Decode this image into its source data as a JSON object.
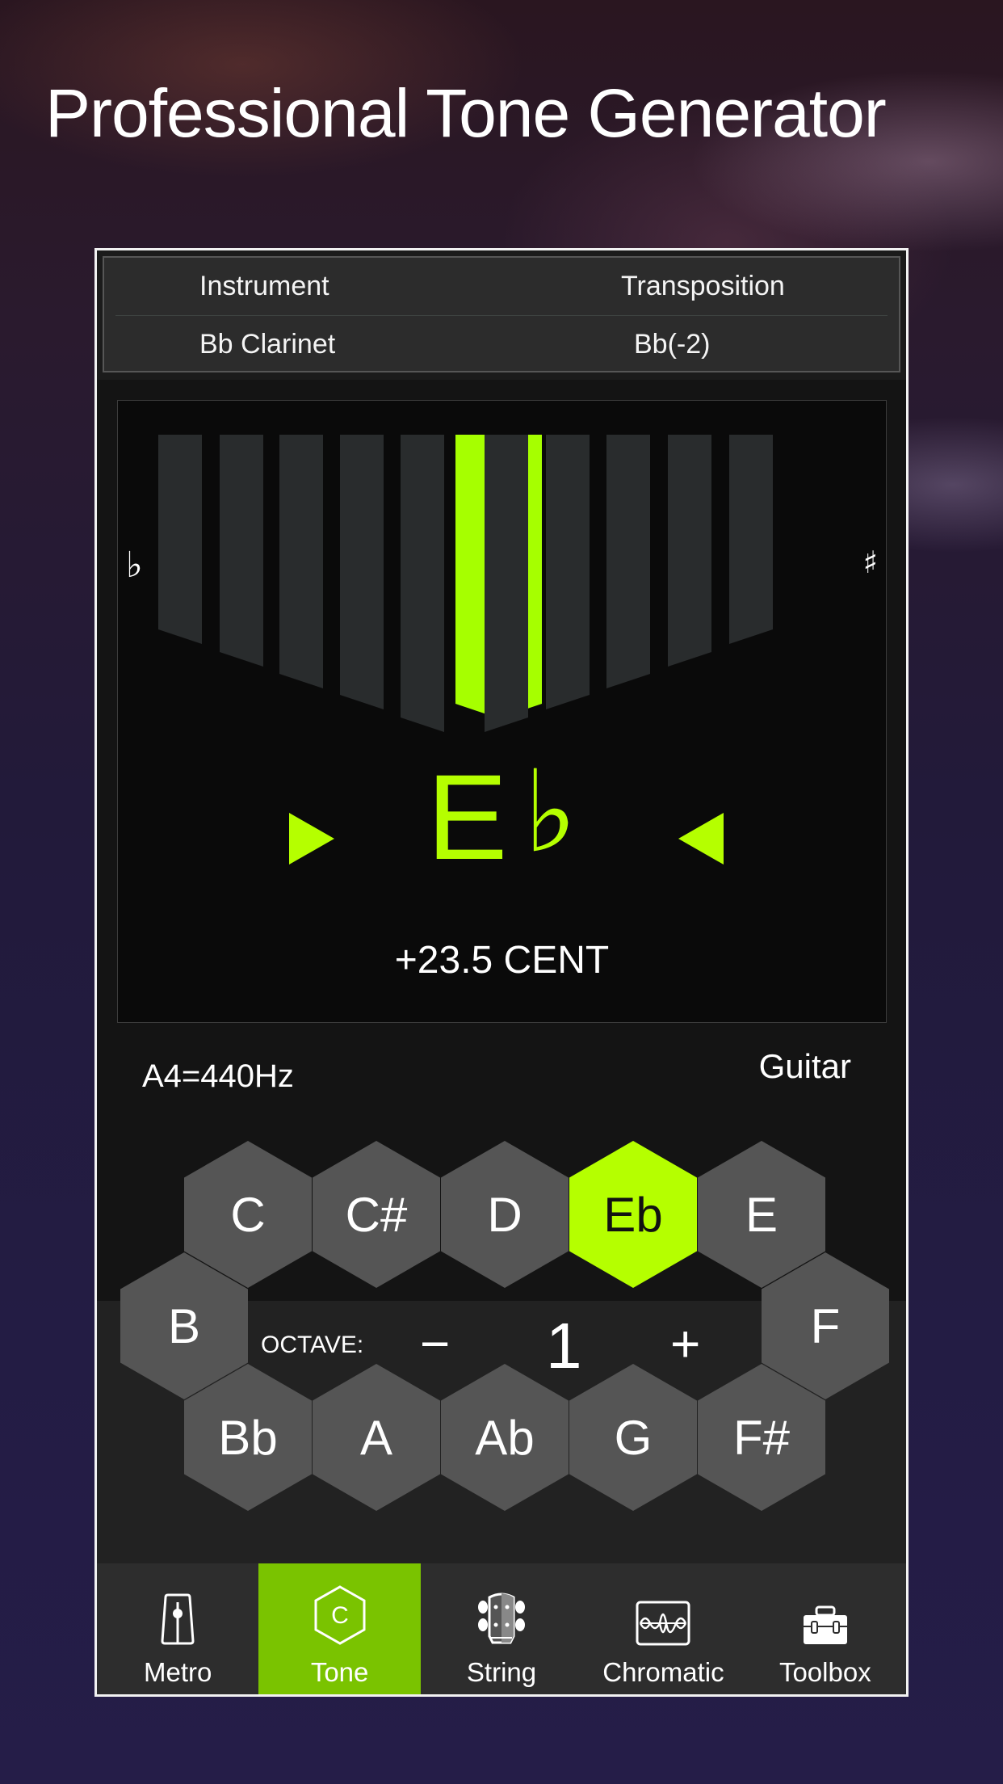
{
  "headline": "Professional Tone Generator",
  "info_table": {
    "headers": [
      "Instrument",
      "Transposition"
    ],
    "values": [
      "Bb Clarinet",
      "Bb(-2)"
    ]
  },
  "tuner": {
    "flat_symbol": "♭",
    "sharp_symbol": "♯",
    "note_letter": "E",
    "note_accidental": "♭",
    "cent_readout": "+23.5 CENT",
    "cents_offset": 23.5,
    "meter_bars": 11,
    "active_bar_index": 5,
    "accent_color": "#a6ff00",
    "inactive_bar_color": "#292c2d"
  },
  "reference": "A4=440Hz",
  "instrument_mode": "Guitar",
  "notes": {
    "top_row": [
      "C",
      "C#",
      "D",
      "Eb",
      "E"
    ],
    "middle_left": "B",
    "middle_right": "F",
    "bottom_row": [
      "Bb",
      "A",
      "Ab",
      "G",
      "F#"
    ],
    "selected": "Eb",
    "selected_color": "#b5ff00"
  },
  "octave": {
    "label": "OCTAVE:",
    "minus": "−",
    "value": "1",
    "plus": "+"
  },
  "tabs": [
    {
      "label": "Metro",
      "icon": "metronome-icon",
      "active": false
    },
    {
      "label": "Tone",
      "icon": "hexagon-c-icon",
      "active": true
    },
    {
      "label": "String",
      "icon": "guitar-headstock-icon",
      "active": false
    },
    {
      "label": "Chromatic",
      "icon": "waveform-icon",
      "active": false
    },
    {
      "label": "Toolbox",
      "icon": "toolbox-icon",
      "active": false
    }
  ],
  "active_tab_color": "#7ac300"
}
